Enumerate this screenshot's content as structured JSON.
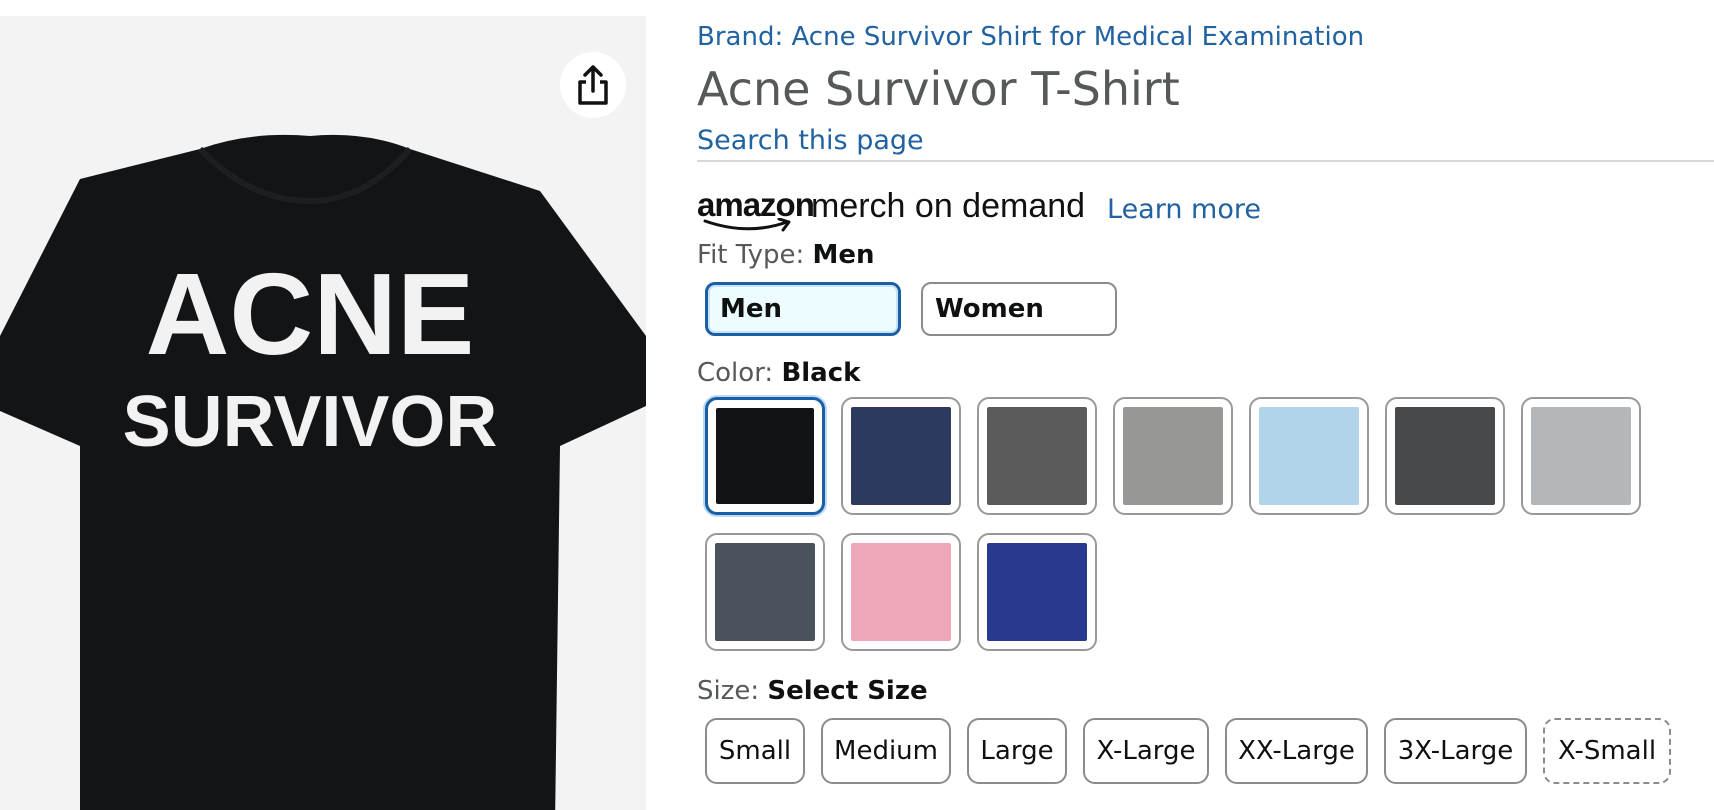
{
  "product": {
    "brand_line": "Brand: Acne Survivor Shirt for Medical Examination",
    "title": "Acne Survivor T-Shirt",
    "search_link": "Search this page",
    "image_text_line1": "ACNE",
    "image_text_line2": "SURVIVOR"
  },
  "merch": {
    "logo_text": "amazon",
    "tagline": "merch on demand",
    "learn_more": "Learn more"
  },
  "fit_type": {
    "label": "Fit Type: ",
    "selected": "Men",
    "options": [
      "Men",
      "Women"
    ]
  },
  "color": {
    "label": "Color: ",
    "selected": "Black",
    "swatches": [
      {
        "name": "black",
        "hex": "#111315"
      },
      {
        "name": "navy",
        "hex": "#2d3a5e"
      },
      {
        "name": "dark-gray",
        "hex": "#5a5b5a"
      },
      {
        "name": "gray",
        "hex": "#979795"
      },
      {
        "name": "light-blue",
        "hex": "#b1d4ea"
      },
      {
        "name": "charcoal",
        "hex": "#48494b"
      },
      {
        "name": "heather-gray",
        "hex": "#b4b7ba"
      },
      {
        "name": "dark-heather",
        "hex": "#4c515e"
      },
      {
        "name": "pink",
        "hex": "#eda7b8"
      },
      {
        "name": "royal-blue",
        "hex": "#293a8e"
      }
    ]
  },
  "size": {
    "label": "Size: ",
    "selected": "Select Size",
    "options": [
      "Small",
      "Medium",
      "Large",
      "X-Large",
      "XX-Large",
      "3X-Large",
      "X-Small"
    ]
  },
  "colors": {
    "link": "#2162a1",
    "selected_border": "#1a5fa3",
    "shirt": "#121416"
  }
}
